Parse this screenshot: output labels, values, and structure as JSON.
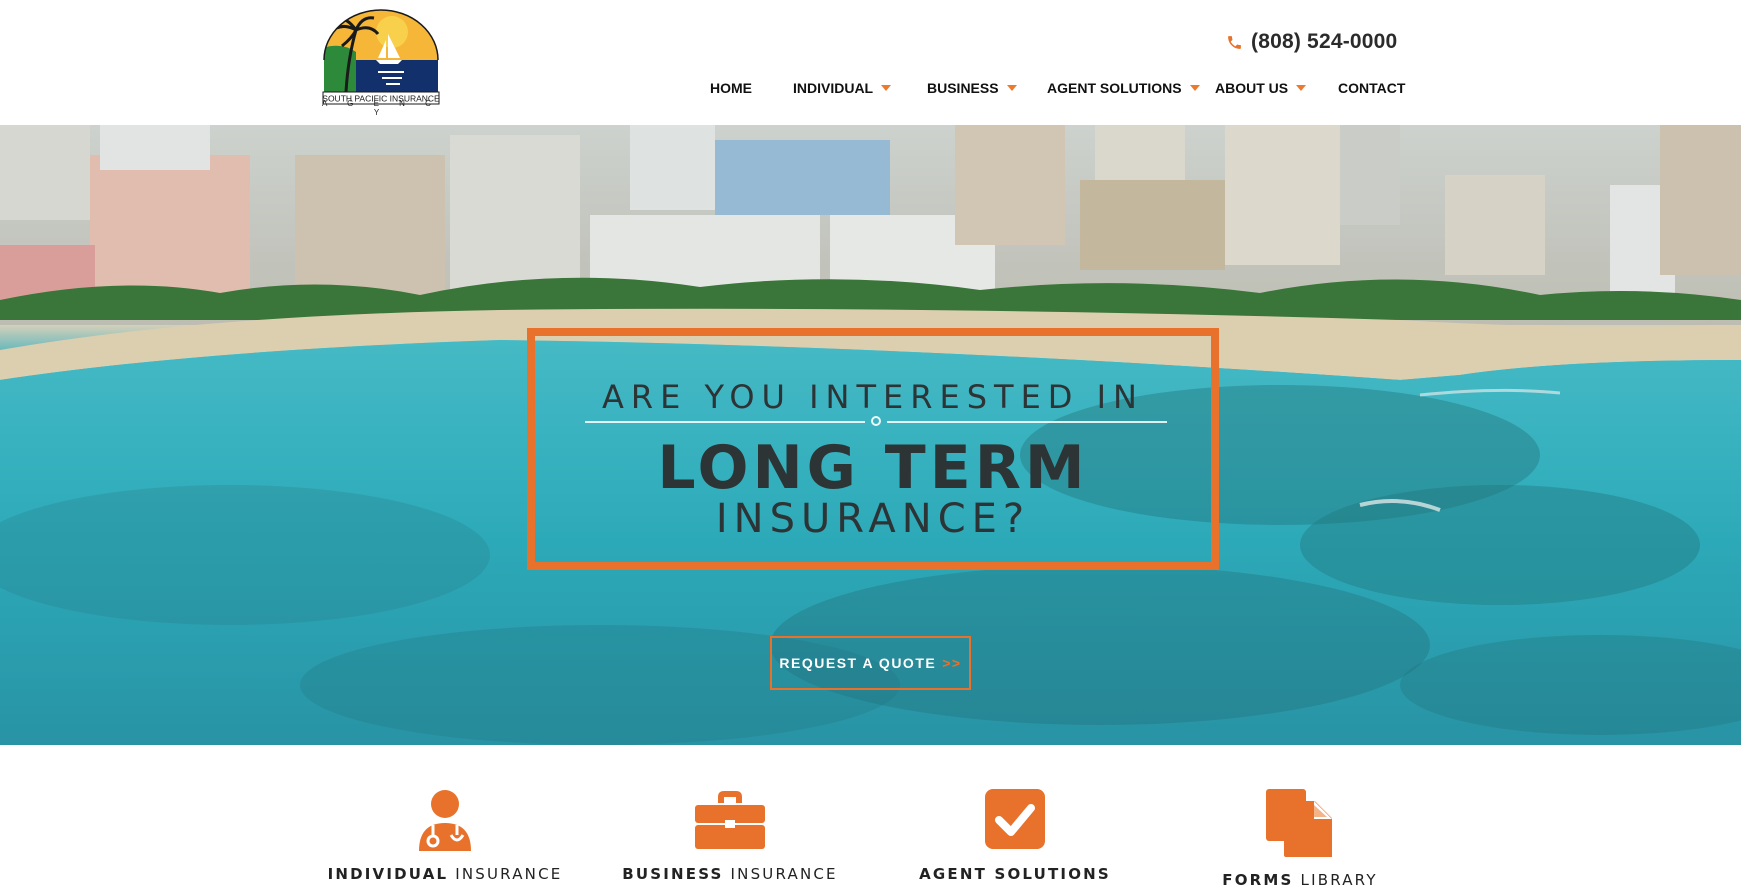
{
  "colors": {
    "accent": "#e8712b",
    "text_dark": "#2d3436",
    "nav_text": "#111111",
    "ocean": "#2fb2c2"
  },
  "header": {
    "logo_text": "SOUTH PACIFIC INSURANCE",
    "logo_subtext": "A G E N C Y",
    "phone_icon": "phone-icon",
    "phone": "(808) 524-0000"
  },
  "nav": {
    "items": [
      {
        "label": "HOME",
        "has_dropdown": false
      },
      {
        "label": "INDIVIDUAL",
        "has_dropdown": true
      },
      {
        "label": "BUSINESS",
        "has_dropdown": true
      },
      {
        "label": "AGENT SOLUTIONS",
        "has_dropdown": true
      },
      {
        "label": "ABOUT US",
        "has_dropdown": true
      },
      {
        "label": "CONTACT",
        "has_dropdown": false
      }
    ]
  },
  "hero": {
    "line1": "ARE YOU INTERESTED IN",
    "line2": "LONG TERM",
    "line3": "INSURANCE?",
    "cta_label": "REQUEST A QUOTE",
    "cta_chevron": ">>"
  },
  "features": [
    {
      "bold": "INDIVIDUAL",
      "rest": " INSURANCE",
      "icon": "doctor-icon"
    },
    {
      "bold": "BUSINESS",
      "rest": " INSURANCE",
      "icon": "briefcase-icon"
    },
    {
      "bold": "AGENT SOLUTIONS",
      "rest": "",
      "icon": "checkbox-icon"
    },
    {
      "bold": "FORMS",
      "rest": " LIBRARY",
      "icon": "documents-icon"
    }
  ]
}
